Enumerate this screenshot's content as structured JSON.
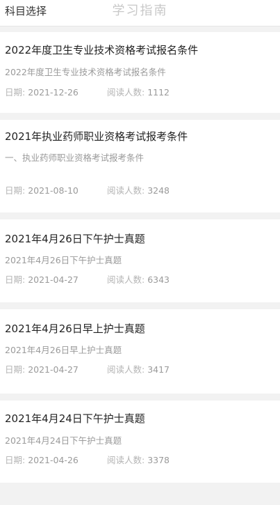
{
  "header": {
    "subject_select": "科目选择",
    "title": "学习指南"
  },
  "articles": [
    {
      "title": "2022年度卫生专业技术资格考试报名条件",
      "summary": "2022年度卫生专业技术资格考试报名条件",
      "date_label": "日期:",
      "date": "2021-12-26",
      "reads_label": "阅读人数:",
      "reads": "1112"
    },
    {
      "title": "2021年执业药师职业资格考试报考条件",
      "summary": "一、执业药师职业资格考试报考条件",
      "date_label": "日期:",
      "date": "2021-08-10",
      "reads_label": "阅读人数:",
      "reads": "3248"
    },
    {
      "title": "2021年4月26日下午护士真题",
      "summary": "2021年4月26日下午护士真题",
      "date_label": "日期:",
      "date": "2021-04-27",
      "reads_label": "阅读人数:",
      "reads": "6343"
    },
    {
      "title": "2021年4月26日早上护士真题",
      "summary": "2021年4月26日早上护士真题",
      "date_label": "日期:",
      "date": "2021-04-27",
      "reads_label": "阅读人数:",
      "reads": "3417"
    },
    {
      "title": "2021年4月24日下午护士真题",
      "summary": "2021年4月24日下午护士真题",
      "date_label": "日期:",
      "date": "2021-04-26",
      "reads_label": "阅读人数:",
      "reads": "3378"
    }
  ]
}
